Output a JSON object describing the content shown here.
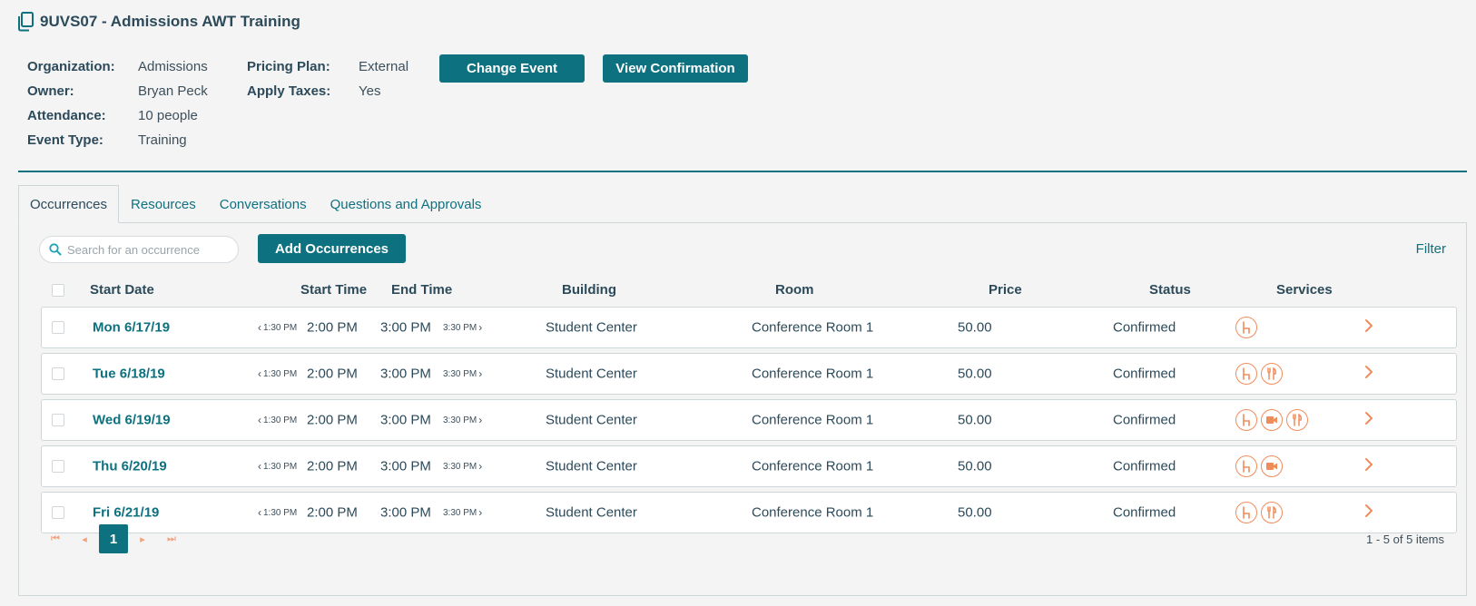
{
  "header": {
    "title": "9UVS07 - Admissions AWT Training",
    "icon": "copy-icon"
  },
  "info": {
    "left": [
      {
        "label": "Organization:",
        "value": "Admissions"
      },
      {
        "label": "Owner:",
        "value": "Bryan Peck"
      },
      {
        "label": "Attendance:",
        "value": "10 people"
      },
      {
        "label": "Event Type:",
        "value": "Training"
      }
    ],
    "mid": [
      {
        "label": "Pricing Plan:",
        "value": "External"
      },
      {
        "label": "Apply Taxes:",
        "value": "Yes"
      }
    ]
  },
  "actions": {
    "change_event": "Change Event",
    "view_confirmation": "View Confirmation"
  },
  "tabs": [
    {
      "label": "Occurrences",
      "active": true
    },
    {
      "label": "Resources"
    },
    {
      "label": "Conversations"
    },
    {
      "label": "Questions and Approvals"
    }
  ],
  "toolbar": {
    "search_placeholder": "Search for an occurrence",
    "add_label": "Add Occurrences",
    "filter_label": "Filter"
  },
  "columns": {
    "start_date": "Start Date",
    "start_time": "Start Time",
    "end_time": "End Time",
    "building": "Building",
    "room": "Room",
    "price": "Price",
    "status": "Status",
    "services": "Services"
  },
  "rows": [
    {
      "date": "Mon 6/17/19",
      "prev_time": "1:30 PM",
      "start": "2:00 PM",
      "end": "3:00 PM",
      "next_time": "3:30 PM",
      "building": "Student Center",
      "room": "Conference Room 1",
      "price": "50.00",
      "status": "Confirmed",
      "services": [
        "chair-icon"
      ]
    },
    {
      "date": "Tue 6/18/19",
      "prev_time": "1:30 PM",
      "start": "2:00 PM",
      "end": "3:00 PM",
      "next_time": "3:30 PM",
      "building": "Student Center",
      "room": "Conference Room 1",
      "price": "50.00",
      "status": "Confirmed",
      "services": [
        "chair-icon",
        "utensils-icon"
      ]
    },
    {
      "date": "Wed 6/19/19",
      "prev_time": "1:30 PM",
      "start": "2:00 PM",
      "end": "3:00 PM",
      "next_time": "3:30 PM",
      "building": "Student Center",
      "room": "Conference Room 1",
      "price": "50.00",
      "status": "Confirmed",
      "services": [
        "chair-icon",
        "video-icon",
        "utensils-icon"
      ]
    },
    {
      "date": "Thu 6/20/19",
      "prev_time": "1:30 PM",
      "start": "2:00 PM",
      "end": "3:00 PM",
      "next_time": "3:30 PM",
      "building": "Student Center",
      "room": "Conference Room 1",
      "price": "50.00",
      "status": "Confirmed",
      "services": [
        "chair-icon",
        "video-icon"
      ]
    },
    {
      "date": "Fri 6/21/19",
      "prev_time": "1:30 PM",
      "start": "2:00 PM",
      "end": "3:00 PM",
      "next_time": "3:30 PM",
      "building": "Student Center",
      "room": "Conference Room 1",
      "price": "50.00",
      "status": "Confirmed",
      "services": [
        "chair-icon",
        "utensils-icon"
      ]
    }
  ],
  "pagination": {
    "current_page": "1",
    "summary": "1 - 5 of 5 items"
  },
  "colors": {
    "accent": "#0e7180",
    "service_icon": "#f08c5a"
  }
}
